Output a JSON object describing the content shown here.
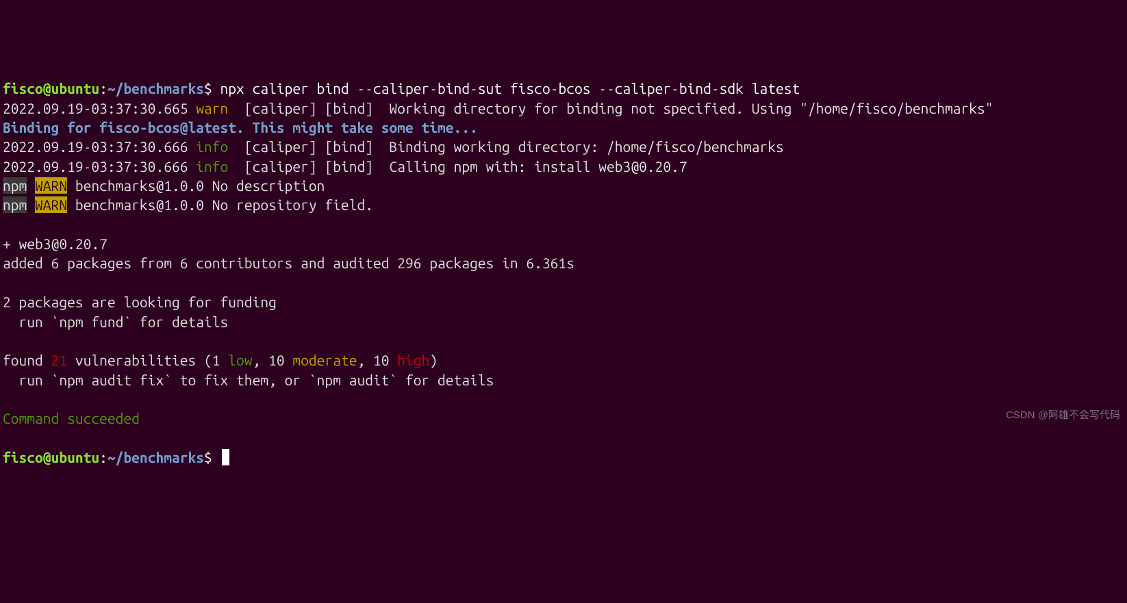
{
  "prompt1": {
    "user": "fisco@ubuntu",
    "sep": ":",
    "path": "~/benchmarks",
    "dollar": "$",
    "command": " npx caliper bind --caliper-bind-sut fisco-bcos --caliper-bind-sdk latest"
  },
  "log1": {
    "ts": "2022.09.19-03:37:30.665 ",
    "level": "warn",
    "pad": "  ",
    "src": "[caliper] [bind]  ",
    "msg": "Working directory for binding not specified. Using \"/home/fisco/benchmarks\""
  },
  "binding": "Binding for fisco-bcos@latest. This might take some time...",
  "log2": {
    "ts": "2022.09.19-03:37:30.666 ",
    "level": "info",
    "pad": "  ",
    "src": "[caliper] [bind]  ",
    "msg": "Binding working directory: /home/fisco/benchmarks"
  },
  "log3": {
    "ts": "2022.09.19-03:37:30.666 ",
    "level": "info",
    "pad": "  ",
    "src": "[caliper] [bind]  ",
    "msg": "Calling npm with: install web3@0.20.7"
  },
  "npmwarn1": {
    "npm": "npm",
    "sp": " ",
    "warn": "WARN",
    "msg": " benchmarks@1.0.0 No description"
  },
  "npmwarn2": {
    "npm": "npm",
    "sp": " ",
    "warn": "WARN",
    "msg": " benchmarks@1.0.0 No repository field."
  },
  "pkg": "+ web3@0.20.7",
  "added": "added 6 packages from 6 contributors and audited 296 packages in 6.361s",
  "funding1": "2 packages are looking for funding",
  "funding2": "  run `npm fund` for details",
  "vuln": {
    "pre": "found ",
    "count": "21",
    "mid1": " vulnerabilities (1 ",
    "low": "low",
    "mid2": ", 10 ",
    "mod": "moderate",
    "mid3": ", 10 ",
    "high": "high",
    "end": ")"
  },
  "audit": "  run `npm audit fix` to fix them, or `npm audit` for details",
  "success": "Command succeeded",
  "prompt2": {
    "user": "fisco@ubuntu",
    "sep": ":",
    "path": "~/benchmarks",
    "dollar": "$"
  },
  "watermark": "CSDN @阿雄不会写代码"
}
